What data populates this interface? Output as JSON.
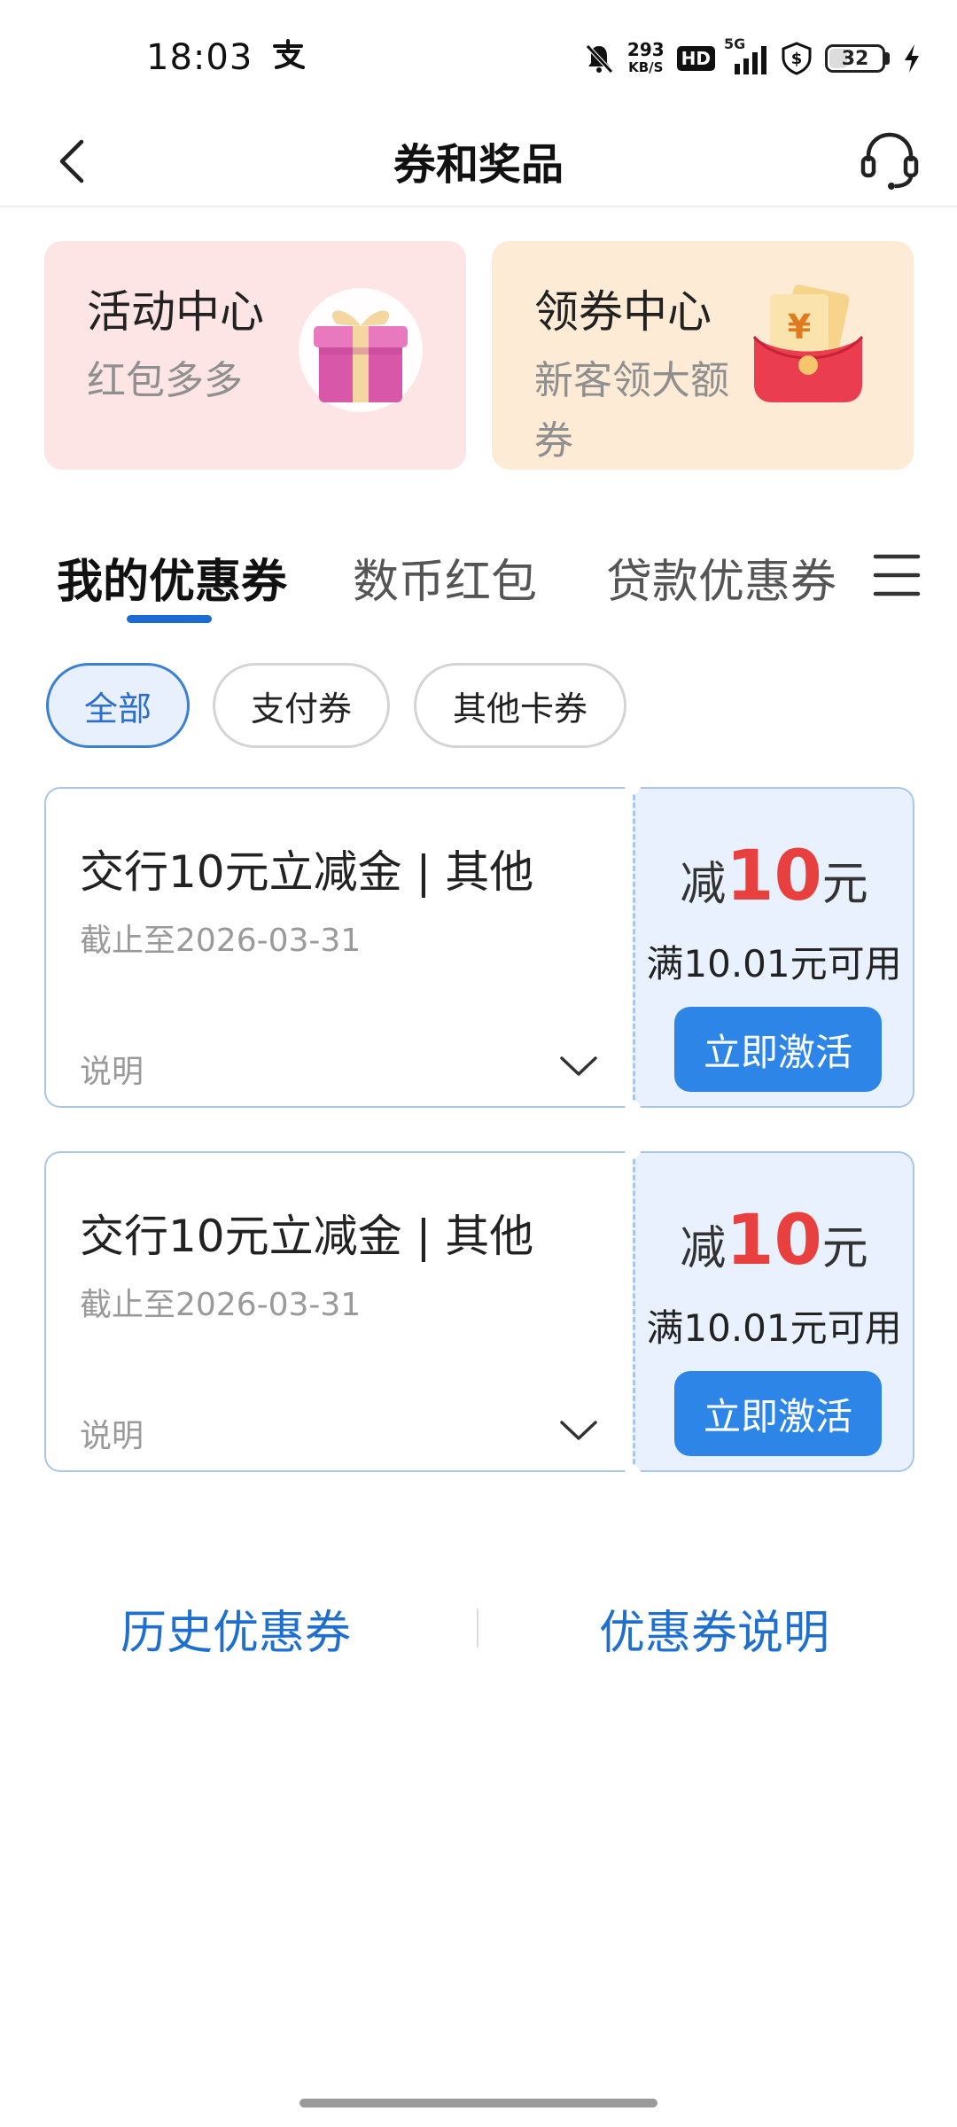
{
  "status_bar": {
    "time": "18:03",
    "net_speed_value": "293",
    "net_speed_unit": "KB/S",
    "hd": "HD",
    "network": "5G",
    "battery": "32",
    "icons": [
      "alipay-icon",
      "mute-icon",
      "signal-icon",
      "vpn-shield-icon",
      "charging-icon"
    ]
  },
  "header": {
    "title": "券和奖品",
    "back_icon": "chevron-left-icon",
    "service_icon": "headset-icon"
  },
  "promos": [
    {
      "title": "活动中心",
      "subtitle": "红包多多",
      "icon": "gift-box-icon",
      "color": "#fde5e6"
    },
    {
      "title": "领券中心",
      "subtitle": "新客领大额券",
      "icon": "red-envelope-icon",
      "color": "#fdebd5"
    }
  ],
  "tabs": [
    {
      "label": "我的优惠券",
      "active": true
    },
    {
      "label": "数币红包",
      "active": false
    },
    {
      "label": "贷款优惠券",
      "active": false
    }
  ],
  "tabs_menu_icon": "menu-icon",
  "filters": [
    {
      "label": "全部",
      "active": true
    },
    {
      "label": "支付券",
      "active": false
    },
    {
      "label": "其他卡券",
      "active": false
    }
  ],
  "coupons": [
    {
      "title": "交行10元立减金 | 其他",
      "expire": "截止至2026-03-31",
      "desc_label": "说明",
      "amount_prefix": "减",
      "amount": "10",
      "amount_unit": "元",
      "threshold": "满10.01元可用",
      "button": "立即激活"
    },
    {
      "title": "交行10元立减金 | 其他",
      "expire": "截止至2026-03-31",
      "desc_label": "说明",
      "amount_prefix": "减",
      "amount": "10",
      "amount_unit": "元",
      "threshold": "满10.01元可用",
      "button": "立即激活"
    }
  ],
  "footer": {
    "history": "历史优惠券",
    "explain": "优惠券说明"
  },
  "colors": {
    "accent": "#1a6cd3",
    "button": "#2e85e8",
    "amount_red": "#e8403f"
  }
}
